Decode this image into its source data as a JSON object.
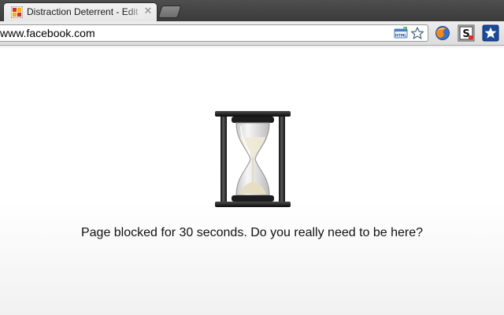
{
  "tab": {
    "title": "Distraction Deterrent - Edit",
    "close_icon": "close-icon"
  },
  "omnibox": {
    "url": "www.facebook.com"
  },
  "toolbar": {
    "page_action_icon": "html-badge-icon",
    "bookmark_icon": "star-outline-icon",
    "extensions": [
      "firefox-like-globe-icon",
      "distraction-deterrent-s-icon",
      "blue-star-extension-icon"
    ]
  },
  "content": {
    "message": "Page blocked for 30 seconds. Do you really need to be here?",
    "image": "hourglass-icon"
  },
  "colors": {
    "tabstrip": "#444444",
    "toolbar": "#e6e6e6",
    "extension_star": "#1a4a9c"
  }
}
